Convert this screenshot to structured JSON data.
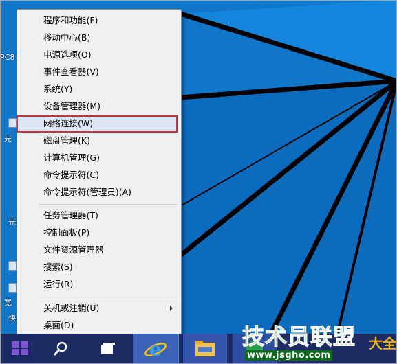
{
  "context_menu": {
    "items": [
      {
        "label": "程序和功能(F)"
      },
      {
        "label": "移动中心(B)"
      },
      {
        "label": "电源选项(O)"
      },
      {
        "label": "事件查看器(V)"
      },
      {
        "label": "系统(Y)"
      },
      {
        "label": "设备管理器(M)"
      },
      {
        "label": "网络连接(W)",
        "highlighted": true
      },
      {
        "label": "磁盘管理(K)"
      },
      {
        "label": "计算机管理(G)"
      },
      {
        "label": "命令提示符(C)"
      },
      {
        "label": "命令提示符(管理员)(A)"
      },
      {
        "label": "任务管理器(T)"
      },
      {
        "label": "控制面板(P)"
      },
      {
        "label": "文件资源管理器"
      },
      {
        "label": "搜索(S)"
      },
      {
        "label": "运行(R)"
      },
      {
        "label": "关机或注销(U)",
        "has_submenu": true
      },
      {
        "label": "桌面(D)"
      }
    ]
  },
  "desktop": {
    "fragments": [
      "PC8",
      "光",
      "光",
      "宽",
      "快"
    ]
  },
  "taskbar": {
    "buttons": [
      "start-icon",
      "search-icon",
      "task-view-icon",
      "internet-explorer-icon",
      "file-explorer-icon",
      "store-icon"
    ]
  },
  "watermark": {
    "title": "技术员联盟",
    "url": "www.jsgho.com",
    "suffix": "大全"
  },
  "colors": {
    "desktop_bg": "#0f76c8",
    "menu_bg": "#f0f0f0",
    "highlight_border": "#c2353e",
    "taskbar_bg": "#1e2b63",
    "watermark_green": "#2db33d"
  }
}
